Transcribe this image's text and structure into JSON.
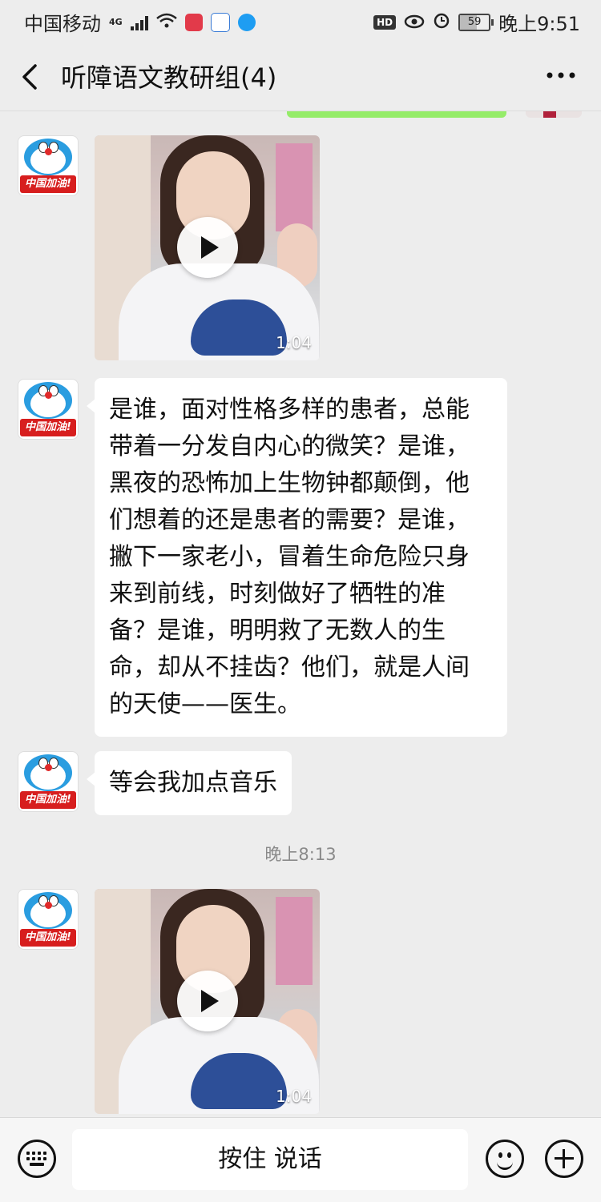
{
  "status_bar": {
    "carrier": "中国移动",
    "network": "4G",
    "battery": "59",
    "battery_level_percent": 59,
    "time": "晚上9:51",
    "hd_label": "HD"
  },
  "header": {
    "title": "听障语文教研组(4)"
  },
  "messages": [
    {
      "type": "video",
      "duration": "1:04"
    },
    {
      "type": "text",
      "text": "是谁，面对性格多样的患者，总能带着一分发自内心的微笑？是谁，黑夜的恐怖加上生物钟都颠倒，他们想着的还是患者的需要？是谁，撇下一家老小，冒着生命危险只身来到前线，时刻做好了牺牲的准备？是谁，明明救了无数人的生命，却从不挂齿？他们，就是人间的天使——医生。"
    },
    {
      "type": "text",
      "text": "等会我加点音乐"
    },
    {
      "type": "timestamp",
      "text": "晚上8:13"
    },
    {
      "type": "video",
      "duration": "1:04"
    }
  ],
  "avatar_label": "中国加油!",
  "input_bar": {
    "hold_to_talk": "按住 说话"
  }
}
